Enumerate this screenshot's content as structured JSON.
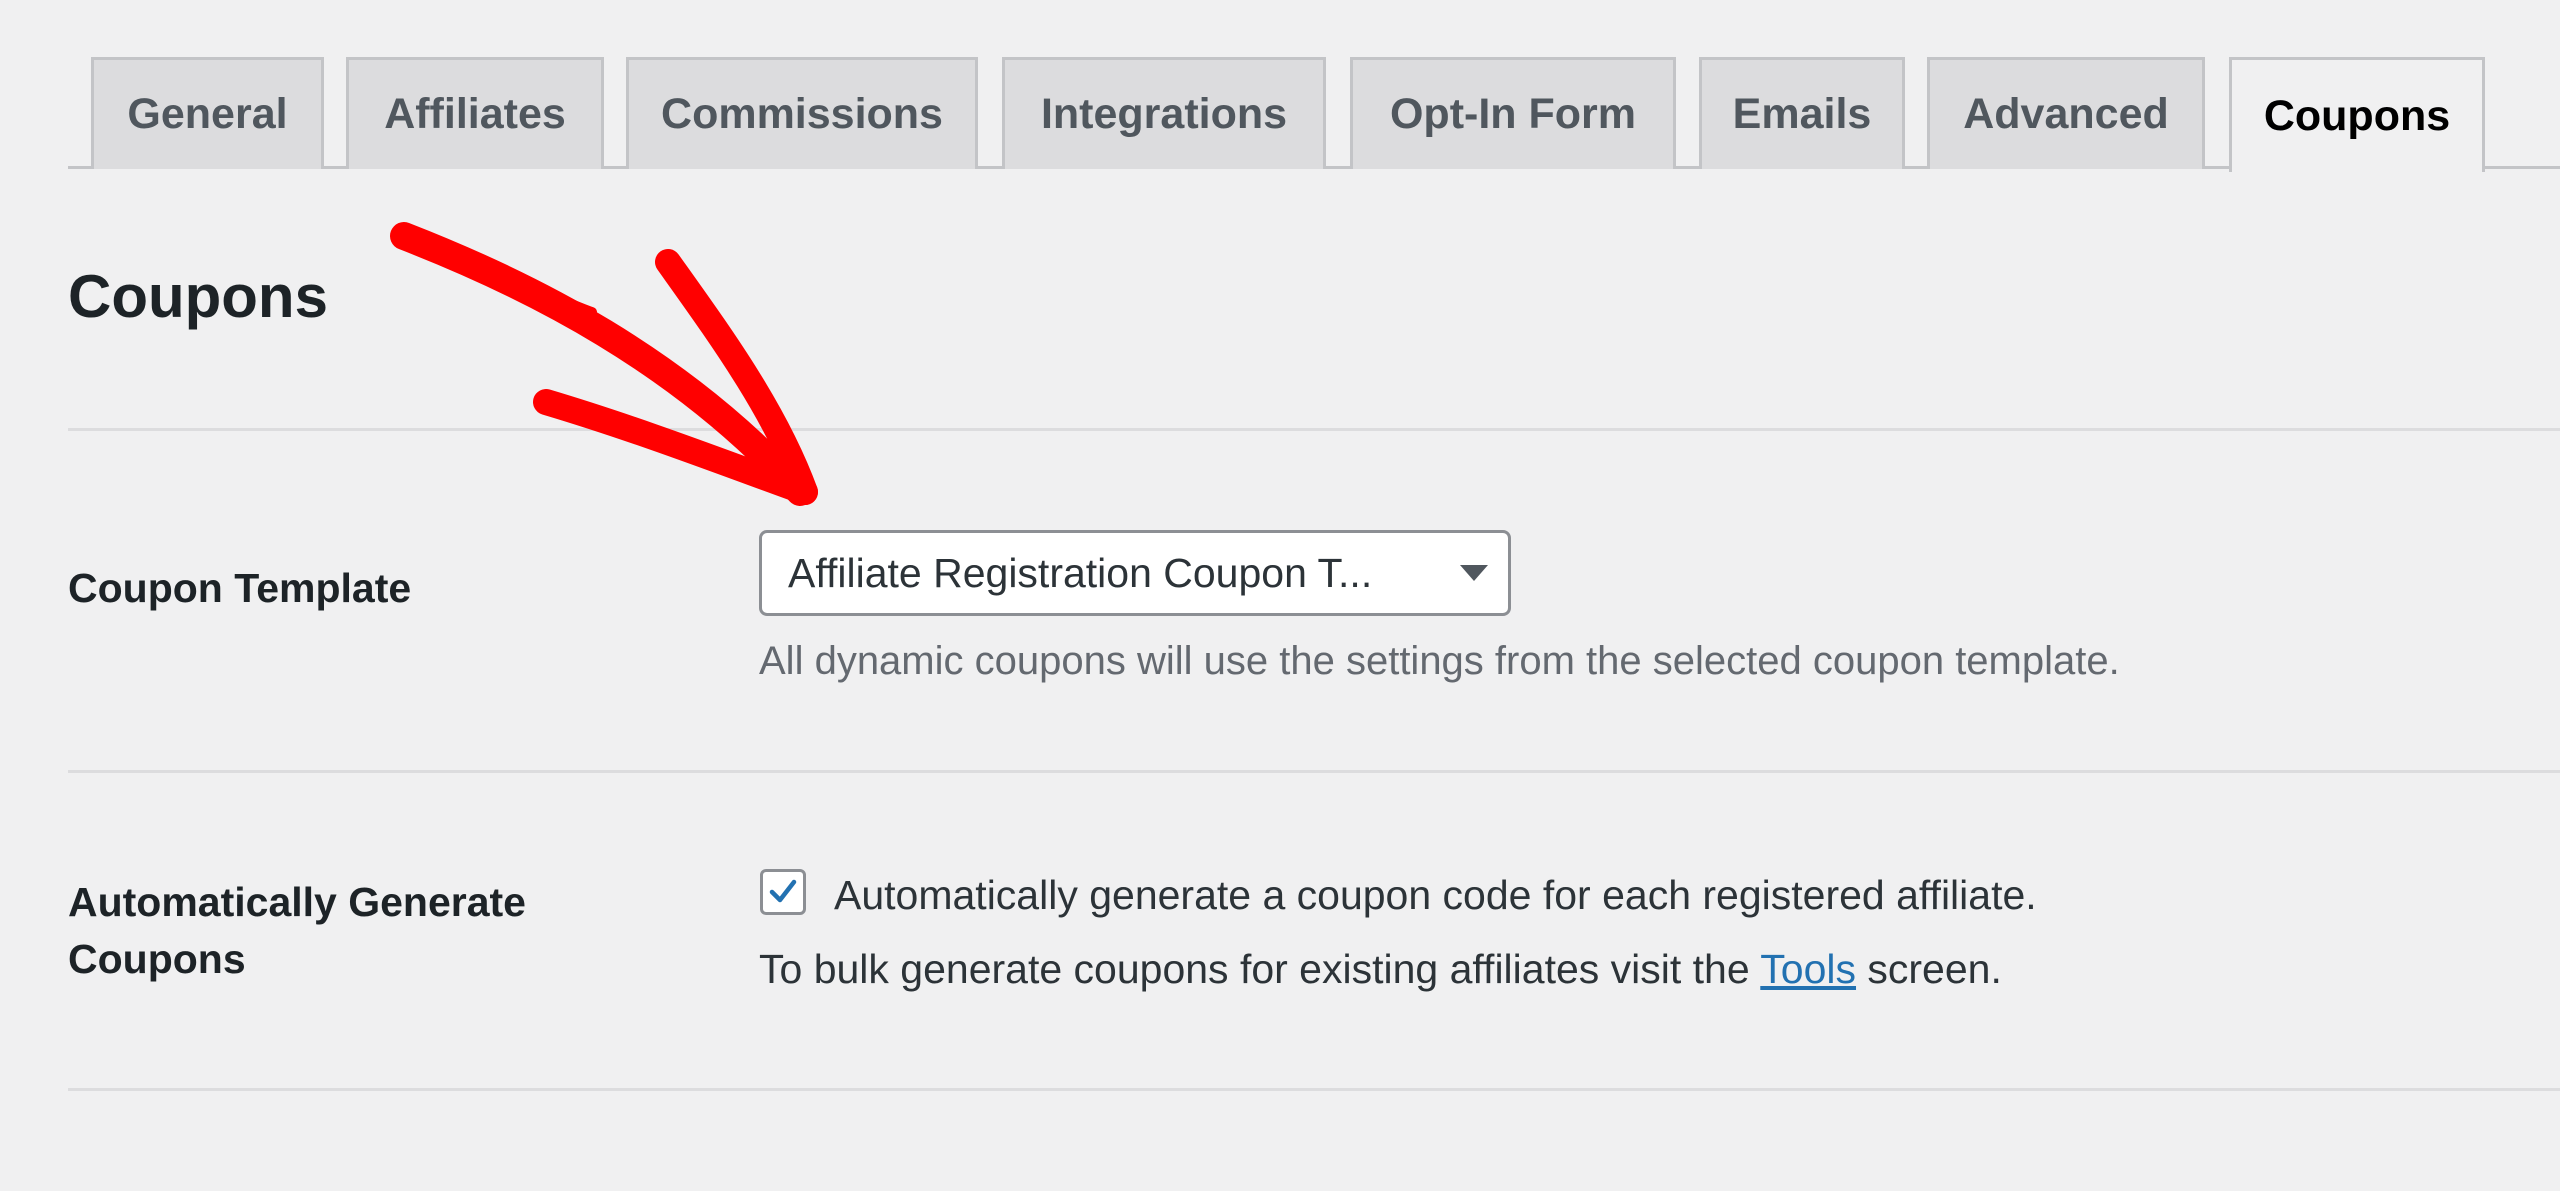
{
  "tabs": [
    {
      "label": "General"
    },
    {
      "label": "Affiliates"
    },
    {
      "label": "Commissions"
    },
    {
      "label": "Integrations"
    },
    {
      "label": "Opt-In Form"
    },
    {
      "label": "Emails"
    },
    {
      "label": "Advanced"
    },
    {
      "label": "Coupons",
      "active": true
    }
  ],
  "page": {
    "title": "Coupons"
  },
  "coupon_template": {
    "label": "Coupon Template",
    "selected_value": "Affiliate Registration Coupon T...",
    "description": "All dynamic coupons will use the settings from the selected coupon template."
  },
  "auto_generate": {
    "label_line1": "Automatically Generate",
    "label_line2": "Coupons",
    "checked": true,
    "checkbox_label": "Automatically generate a coupon code for each registered affiliate.",
    "help_before": "To bulk generate coupons for existing affiliates visit the ",
    "help_link": "Tools",
    "help_after": " screen."
  },
  "colors": {
    "background": "#f0f0f1",
    "accent": "#2271b1",
    "annotation_arrow": "#ff0000"
  },
  "icons": {
    "dropdown": "chevron-down-icon",
    "check": "checkmark-icon",
    "annotation": "red-arrow-icon"
  }
}
